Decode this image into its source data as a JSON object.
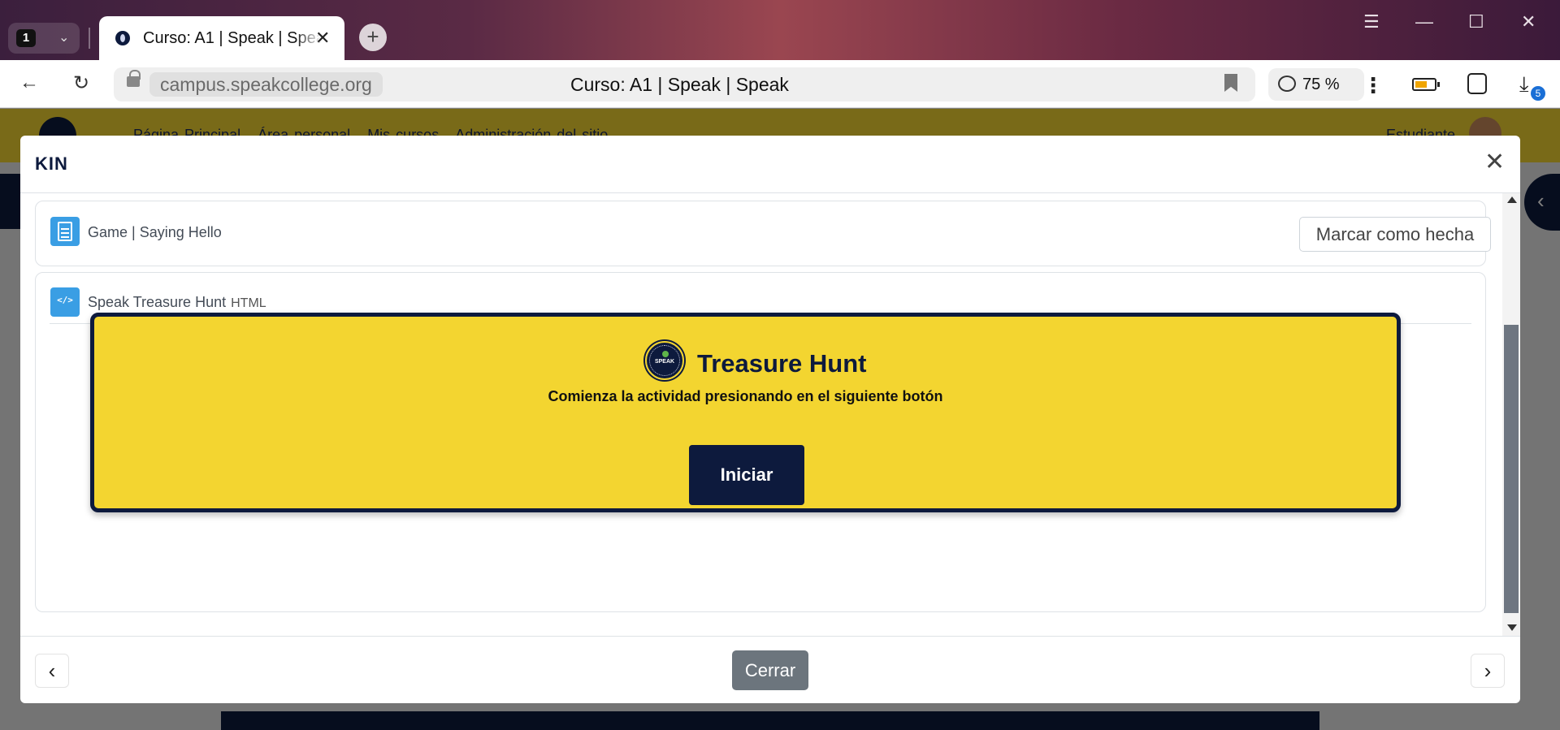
{
  "browser": {
    "tab_count": "1",
    "tab_title": "Curso: A1 | Speak | Speak",
    "url": "campus.speakcollege.org",
    "page_title": "Curso: A1 | Speak | Speak",
    "zoom": "75 %",
    "downloads_badge": "5"
  },
  "site_nav": {
    "links": [
      "Página Principal",
      "Área personal",
      "Mis cursos",
      "Administración del sitio"
    ],
    "user": "Estudiante"
  },
  "modal": {
    "title": "KIN",
    "activities": [
      {
        "name": "Game | Saying Hello",
        "icon": "page-icon",
        "button": "Marcar como hecha"
      },
      {
        "name": "Speak Treasure Hunt",
        "type": "HTML",
        "icon": "html-file-icon"
      }
    ],
    "treasure_hunt": {
      "title": "Treasure Hunt",
      "subtitle": "Comienza la actividad presionando en el siguiente botón",
      "button": "Iniciar",
      "logo_text": "SPEAK"
    },
    "footer": {
      "close": "Cerrar",
      "prev": "‹",
      "next": "›"
    }
  },
  "colors": {
    "brand_yellow": "#f3d530",
    "brand_navy": "#0d1a3d",
    "activity_icon_blue": "#3a9ee4",
    "close_button_gray": "#6c757d"
  }
}
